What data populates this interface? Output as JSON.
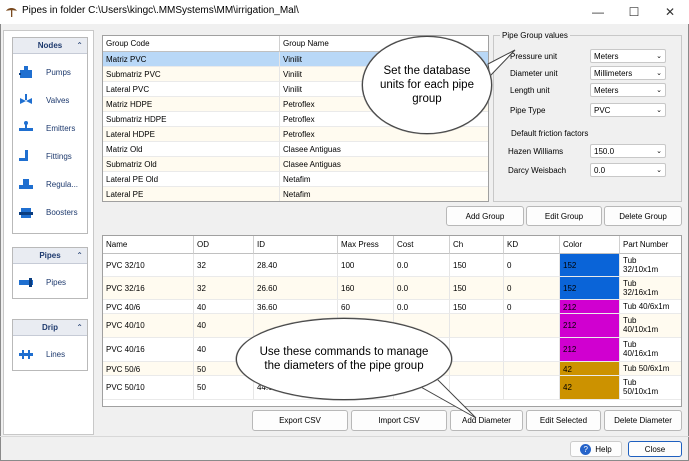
{
  "window": {
    "title": "Pipes in folder C:\\Users\\kingc\\.MMSystems\\MM\\irrigation_Mal\\"
  },
  "sidebar": {
    "groups": [
      {
        "title": "Nodes",
        "items": [
          {
            "label": "Pumps",
            "icon": "pump-icon"
          },
          {
            "label": "Valves",
            "icon": "valve-icon"
          },
          {
            "label": "Emitters",
            "icon": "emitter-icon"
          },
          {
            "label": "Fittings",
            "icon": "fitting-icon"
          },
          {
            "label": "Regula...",
            "icon": "regulator-icon"
          },
          {
            "label": "Boosters",
            "icon": "booster-icon"
          }
        ]
      },
      {
        "title": "Pipes",
        "items": [
          {
            "label": "Pipes",
            "icon": "pipe-icon"
          }
        ]
      },
      {
        "title": "Drip",
        "items": [
          {
            "label": "Lines",
            "icon": "drip-line-icon"
          }
        ]
      }
    ]
  },
  "group_table": {
    "headers": [
      "Group Code",
      "Group Name"
    ],
    "rows": [
      [
        "Matriz PVC",
        "Vinilit"
      ],
      [
        "Submatriz PVC",
        "Vinilit"
      ],
      [
        "Lateral PVC",
        "Vinilit"
      ],
      [
        "Matriz HDPE",
        "Petroflex"
      ],
      [
        "Submatriz HDPE",
        "Petroflex"
      ],
      [
        "Lateral HDPE",
        "Petroflex"
      ],
      [
        "Matriz Old",
        "Clasee Antiguas"
      ],
      [
        "Submatriz Old",
        "Clasee Antiguas"
      ],
      [
        "Lateral PE Old",
        "Netafim"
      ],
      [
        "Lateral PE",
        "Netafim"
      ]
    ],
    "selected_row": 0
  },
  "pipe_group_values": {
    "title": "Pipe Group values",
    "fields": [
      {
        "label": "Pressure unit",
        "value": "Meters"
      },
      {
        "label": "Diameter unit",
        "value": "Millimeters"
      },
      {
        "label": "Length unit",
        "value": "Meters"
      },
      {
        "label": "Pipe Type",
        "value": "PVC"
      }
    ],
    "friction_title": "Default friction factors",
    "friction_fields": [
      {
        "label": "Hazen Williams",
        "value": "150.0"
      },
      {
        "label": "Darcy Weisbach",
        "value": "0.0"
      }
    ]
  },
  "group_buttons": {
    "add": "Add Group",
    "edit": "Edit Group",
    "delete": "Delete Group"
  },
  "diameter_table": {
    "headers": [
      "Name",
      "OD",
      "ID",
      "Max Press",
      "Cost",
      "Ch",
      "KD",
      "Color",
      "Part Number"
    ],
    "rows": [
      {
        "name": "PVC 32/10",
        "od": "32",
        "id": "28.40",
        "maxp": "100",
        "cost": "0.0",
        "ch": "150",
        "kd": "0",
        "color": "152",
        "color_hex": "#0a64d8",
        "part": "Tub\n32/10x1m"
      },
      {
        "name": "PVC 32/16",
        "od": "32",
        "id": "26.60",
        "maxp": "160",
        "cost": "0.0",
        "ch": "150",
        "kd": "0",
        "color": "152",
        "color_hex": "#0a64d8",
        "part": "Tub\n32/16x1m"
      },
      {
        "name": "PVC 40/6",
        "od": "40",
        "id": "36.60",
        "maxp": "60",
        "cost": "0.0",
        "ch": "150",
        "kd": "0",
        "color": "212",
        "color_hex": "#d000d0",
        "part": "Tub 40/6x1m"
      },
      {
        "name": "PVC 40/10",
        "od": "40",
        "id": "",
        "maxp": "",
        "cost": "",
        "ch": "",
        "kd": "",
        "color": "212",
        "color_hex": "#d000d0",
        "part": "Tub\n40/10x1m"
      },
      {
        "name": "PVC 40/16",
        "od": "40",
        "id": "",
        "maxp": "",
        "cost": "",
        "ch": "",
        "kd": "",
        "color": "212",
        "color_hex": "#d000d0",
        "part": "Tub\n40/16x1m"
      },
      {
        "name": "PVC 50/6",
        "od": "50",
        "id": "",
        "maxp": "",
        "cost": "",
        "ch": "",
        "kd": "",
        "color": "42",
        "color_hex": "#cc9200",
        "part": "Tub 50/6x1m"
      },
      {
        "name": "PVC 50/10",
        "od": "50",
        "id": "44.60",
        "maxp": "",
        "cost": "",
        "ch": "",
        "kd": "",
        "color": "42",
        "color_hex": "#cc9200",
        "part": "Tub\n50/10x1m"
      }
    ]
  },
  "diameter_buttons": {
    "export": "Export CSV",
    "import": "Import CSV",
    "add": "Add Diameter",
    "edit": "Edit Selected",
    "delete": "Delete Diameter"
  },
  "footer": {
    "help": "Help",
    "close": "Close"
  },
  "callouts": [
    {
      "text": "Set the database units for each pipe group"
    },
    {
      "text": "Use these commands to manage the diameters of the pipe group"
    }
  ]
}
